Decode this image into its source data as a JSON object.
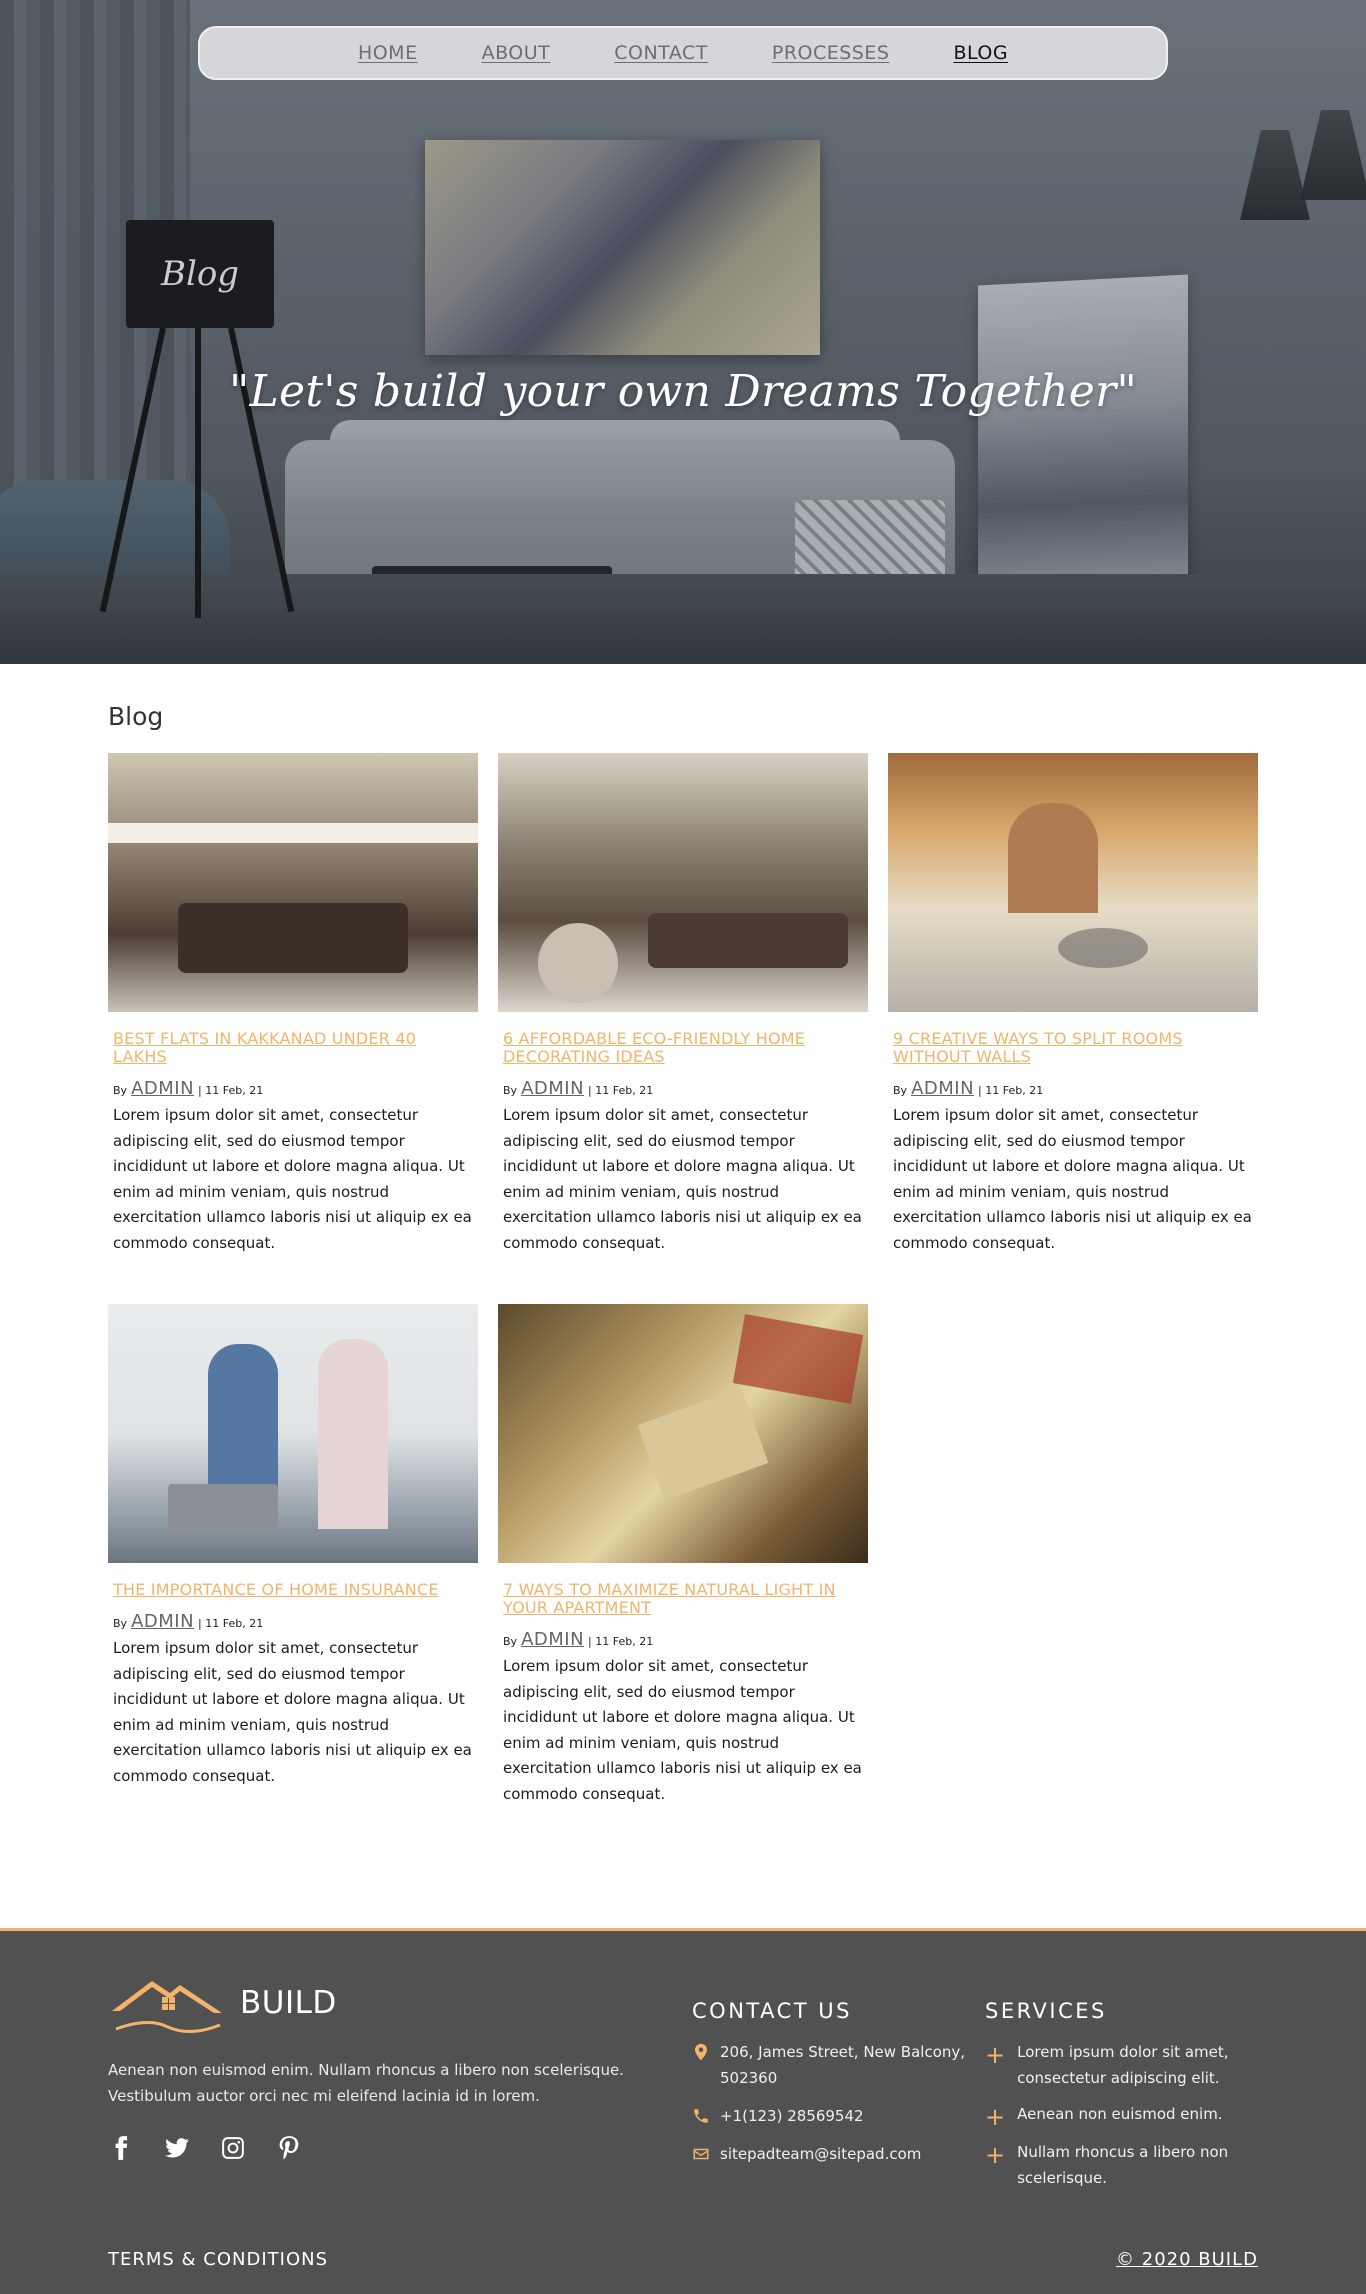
{
  "nav": {
    "items": [
      {
        "label": "HOME",
        "active": false
      },
      {
        "label": "ABOUT",
        "active": false
      },
      {
        "label": "CONTACT",
        "active": false
      },
      {
        "label": "PROCESSES",
        "active": false
      },
      {
        "label": "BLOG",
        "active": true
      }
    ]
  },
  "hero": {
    "lamp_label": "Blog",
    "tagline": "\"Let's build your own Dreams Together\""
  },
  "blog": {
    "heading": "Blog",
    "posts": [
      {
        "title": "BEST FLATS IN KAKKANAD UNDER 40 LAKHS",
        "by": "By",
        "author": "ADMIN",
        "date": "| 11 Feb, 21",
        "excerpt": "Lorem ipsum dolor sit amet, consectetur adipiscing elit, sed do eiusmod tempor incididunt ut labore et dolore magna aliqua. Ut enim ad minim veniam, quis nostrud exercitation ullamco laboris nisi ut aliquip ex ea commodo consequat."
      },
      {
        "title": "6 AFFORDABLE ECO-FRIENDLY HOME DECORATING IDEAS",
        "by": "By",
        "author": "ADMIN",
        "date": "| 11 Feb, 21",
        "excerpt": "Lorem ipsum dolor sit amet, consectetur adipiscing elit, sed do eiusmod tempor incididunt ut labore et dolore magna aliqua. Ut enim ad minim veniam, quis nostrud exercitation ullamco laboris nisi ut aliquip ex ea commodo consequat."
      },
      {
        "title": "9 CREATIVE WAYS TO SPLIT ROOMS WITHOUT WALLS",
        "by": "By",
        "author": "ADMIN",
        "date": "| 11 Feb, 21",
        "excerpt": "Lorem ipsum dolor sit amet, consectetur adipiscing elit, sed do eiusmod tempor incididunt ut labore et dolore magna aliqua. Ut enim ad minim veniam, quis nostrud exercitation ullamco laboris nisi ut aliquip ex ea commodo consequat."
      },
      {
        "title": "THE IMPORTANCE OF HOME INSURANCE",
        "by": "By",
        "author": "ADMIN",
        "date": "| 11 Feb, 21",
        "excerpt": "Lorem ipsum dolor sit amet, consectetur adipiscing elit, sed do eiusmod tempor incididunt ut labore et dolore magna aliqua. Ut enim ad minim veniam, quis nostrud exercitation ullamco laboris nisi ut aliquip ex ea commodo consequat."
      },
      {
        "title": "7 WAYS TO MAXIMIZE NATURAL LIGHT IN YOUR APARTMENT",
        "by": "By",
        "author": "ADMIN",
        "date": "| 11 Feb, 21",
        "excerpt": "Lorem ipsum dolor sit amet, consectetur adipiscing elit, sed do eiusmod tempor incididunt ut labore et dolore magna aliqua. Ut enim ad minim veniam, quis nostrud exercitation ullamco laboris nisi ut aliquip ex ea commodo consequat."
      }
    ]
  },
  "footer": {
    "brand": "BUILD",
    "description": "Aenean non euismod enim. Nullam rhoncus a libero non scelerisque. Vestibulum auctor orci nec mi eleifend lacinia id in lorem.",
    "social_icons": [
      "facebook-icon",
      "twitter-icon",
      "instagram-icon",
      "pinterest-icon"
    ],
    "contact": {
      "heading": "CONTACT US",
      "address": "206, James Street, New Balcony, 502360",
      "phone": "+1(123) 28569542",
      "email": "sitepadteam@sitepad.com"
    },
    "services": {
      "heading": "SERVICES",
      "items": [
        "Lorem ipsum dolor sit amet, consectetur adipiscing elit.",
        "Aenean non euismod enim.",
        "Nullam rhoncus a libero non scelerisque."
      ]
    },
    "terms": "TERMS & CONDITIONS",
    "copyright": "© 2020 BUILD"
  },
  "colors": {
    "accent": "#f2b46a",
    "footer_bg": "#515151",
    "nav_bg": "#e4e5e7"
  }
}
